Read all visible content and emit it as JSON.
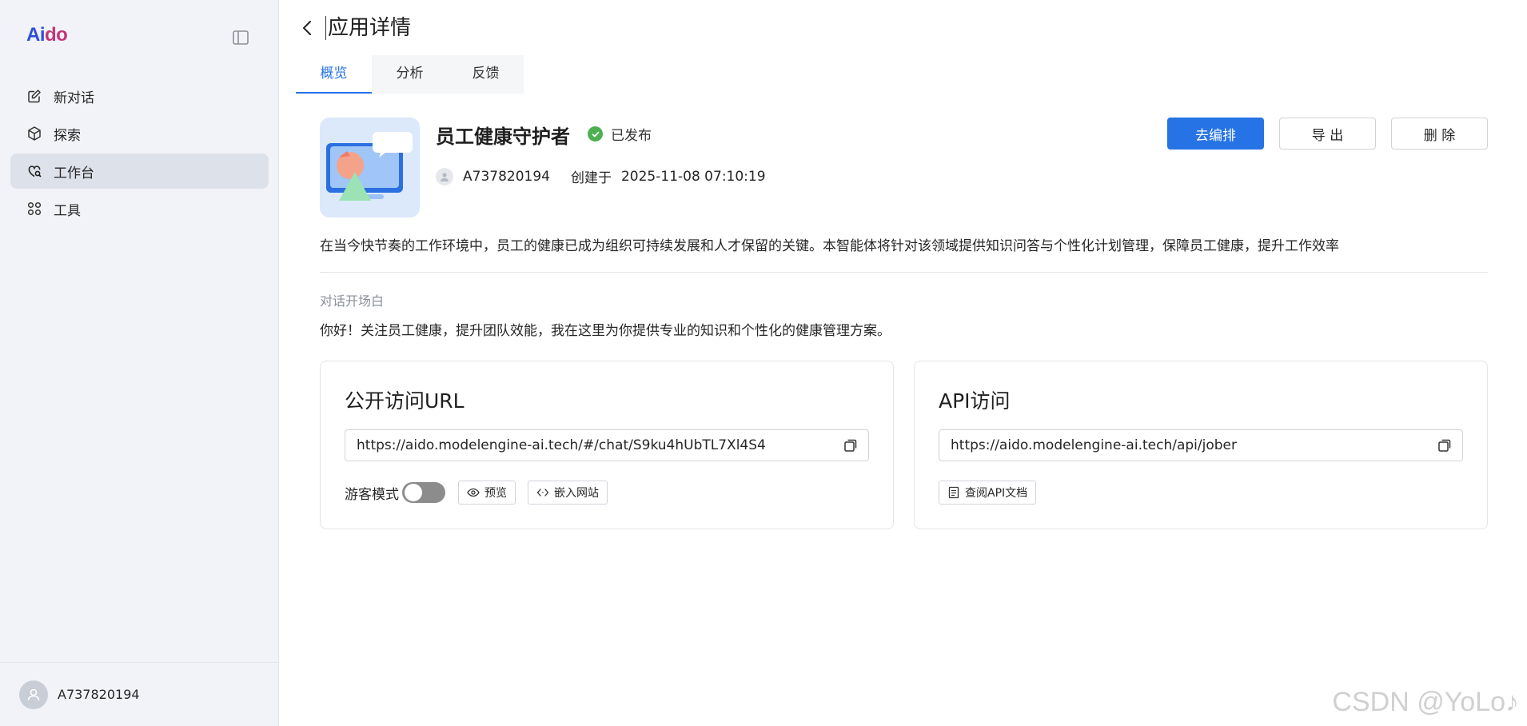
{
  "brand": {
    "part1": "Ai",
    "part2": "do",
    "color_primary": "#2e4fd8",
    "color_secondary": "#c2367a"
  },
  "sidebar": {
    "items": [
      {
        "label": "新对话",
        "icon": "edit-icon"
      },
      {
        "label": "探索",
        "icon": "explore-icon"
      },
      {
        "label": "工作台",
        "icon": "workbench-icon",
        "active": true
      },
      {
        "label": "工具",
        "icon": "tools-icon"
      }
    ],
    "user": "A737820194"
  },
  "header": {
    "title": "应用详情"
  },
  "tabs": [
    {
      "label": "概览",
      "active": true
    },
    {
      "label": "分析"
    },
    {
      "label": "反馈"
    }
  ],
  "app": {
    "name": "员工健康守护者",
    "status": "已发布",
    "author": "A737820194",
    "created_label": "创建于",
    "created_at": "2025-11-08 07:10:19",
    "description": "在当今快节奏的工作环境中，员工的健康已成为组织可持续发展和人才保留的关键。本智能体将针对该领域提供知识问答与个性化计划管理，保障员工健康，提升工作效率"
  },
  "actions": {
    "arrange": "去编排",
    "export": "导 出",
    "delete": "删 除"
  },
  "opening": {
    "label": "对话开场白",
    "text": "你好！关注员工健康，提升团队效能，我在这里为你提供专业的知识和个性化的健康管理方案。"
  },
  "public_url": {
    "title": "公开访问URL",
    "url": "https://aido.modelengine-ai.tech/#/chat/S9ku4hUbTL7Xl4S4",
    "guest_mode_label": "游客模式",
    "guest_mode_on": false,
    "preview": "预览",
    "embed": "嵌入网站"
  },
  "api": {
    "title": "API访问",
    "url": "https://aido.modelengine-ai.tech/api/jober",
    "docs": "查阅API文档"
  },
  "watermark": "CSDN @YoLo♪",
  "colors": {
    "accent": "#2673e6",
    "success": "#4caf50"
  }
}
